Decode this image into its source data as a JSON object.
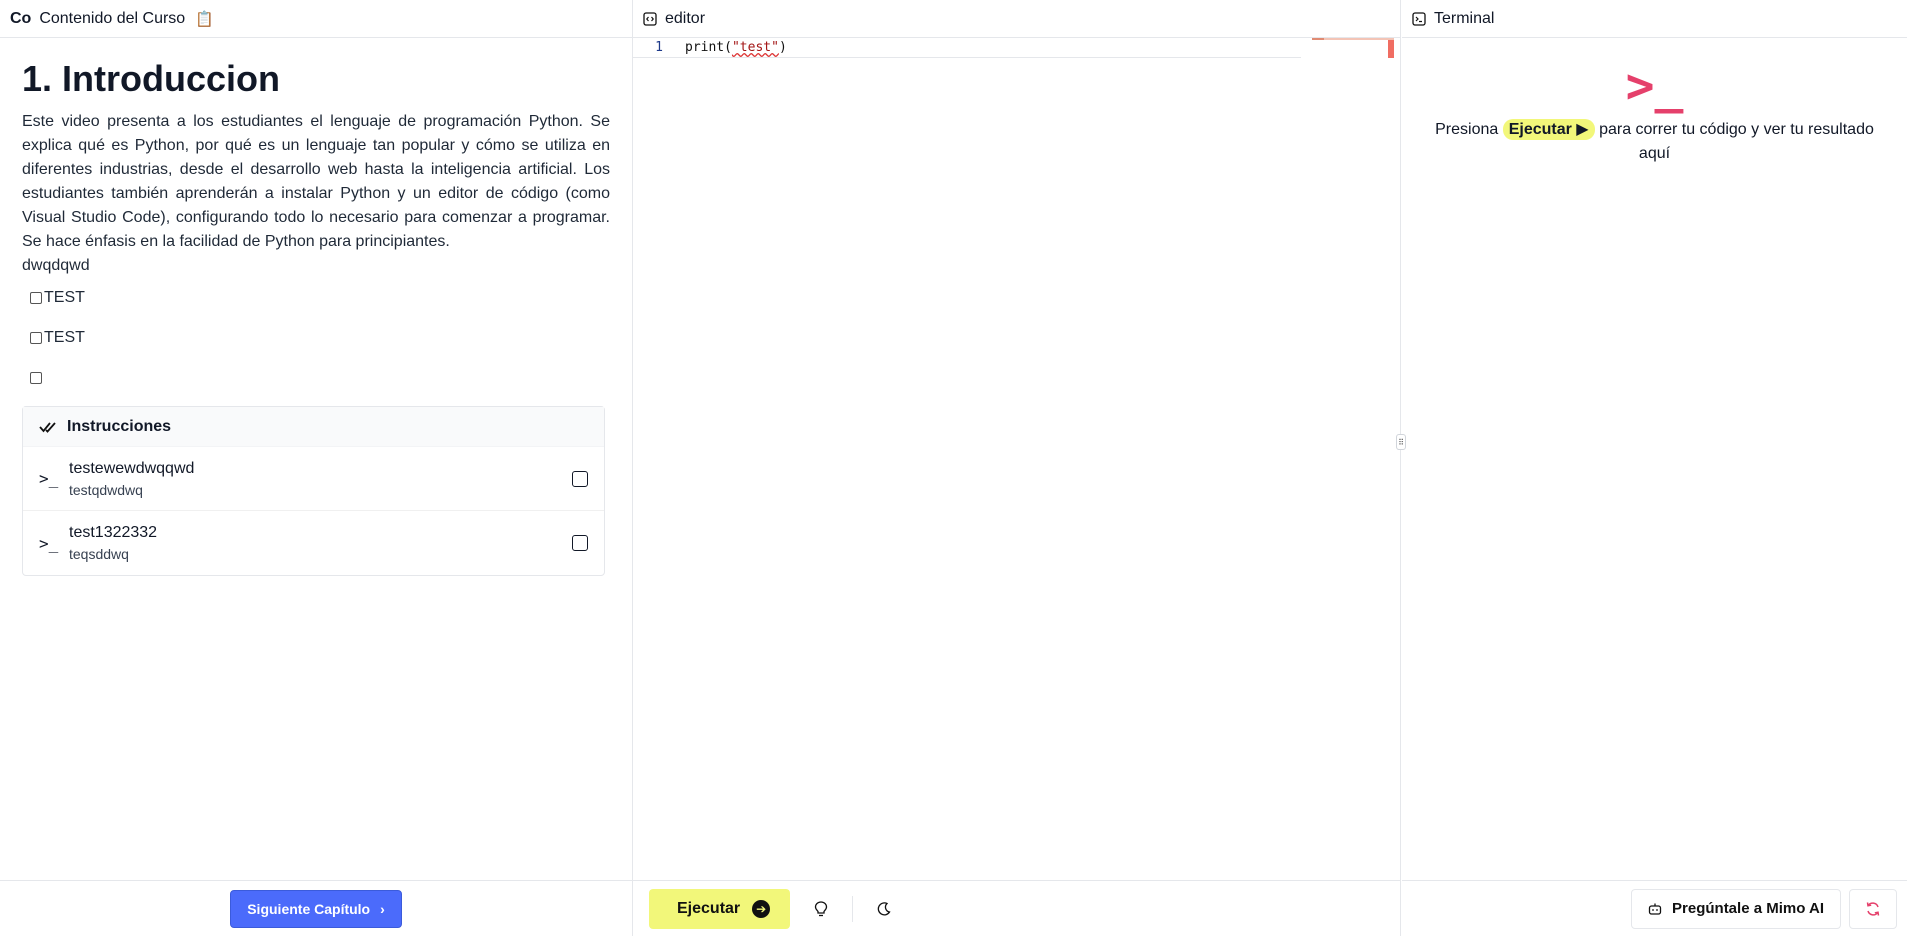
{
  "left": {
    "logo": "Co",
    "title": "Contenido del Curso",
    "clip_icon": "📋",
    "chapter_title": "1. Introduccion",
    "description": "Este video presenta a los estudiantes el lenguaje de programación Python. Se explica qué es Python, por qué es un lenguaje tan popular y cómo se utiliza en diferentes industrias, desde el desarrollo web hasta la inteligencia artificial. Los estudiantes también aprenderán a instalar Python y un editor de código (como Visual Studio Code), configurando todo lo necesario para comenzar a programar. Se hace énfasis en la facilidad de Python para principiantes.",
    "extra_text": "dwqdqwd",
    "checkbox_labels": [
      "TEST",
      "TEST",
      ""
    ],
    "instructions_heading": "Instrucciones",
    "instructions": [
      {
        "title": "testewewdwqqwd",
        "subtitle": "testqdwdwq"
      },
      {
        "title": "test1322332",
        "subtitle": "teqsddwq"
      }
    ],
    "next_button": "Siguiente Capítulo"
  },
  "editor": {
    "title": "editor",
    "line_number": "1",
    "code_prefix": "print(",
    "code_string": "\"test\"",
    "code_suffix": ")",
    "run_button": "Ejecutar"
  },
  "terminal": {
    "title": "Terminal",
    "prompt_symbol": ">_",
    "msg_before": "Presiona",
    "msg_key": "Ejecutar ▶",
    "msg_after": "para correr tu código y ver tu resultado aquí",
    "ai_button": "Pregúntale a Mimo AI"
  },
  "colors": {
    "accent_blue": "#4b6bfb",
    "run_yellow": "#f2f77a",
    "terminal_pink": "#e5406b"
  }
}
